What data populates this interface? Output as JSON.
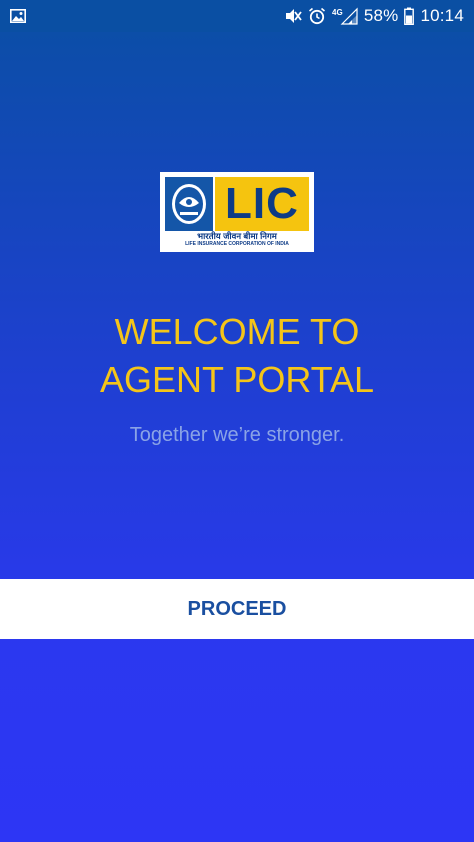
{
  "status_bar": {
    "battery": "58%",
    "time": "10:14",
    "network": "4G",
    "icons": [
      "image-icon",
      "mute-icon",
      "alarm-icon",
      "signal-icon",
      "battery-icon"
    ]
  },
  "logo": {
    "name": "LIC",
    "hindi": "भारतीय जीवन बीमा निगम",
    "subtitle": "LIFE INSURANCE CORPORATION OF INDIA"
  },
  "welcome": {
    "line1": "WELCOME TO",
    "line2": "AGENT PORTAL",
    "tagline": "Together we’re stronger."
  },
  "actions": {
    "proceed_label": "PROCEED"
  },
  "colors": {
    "status_bar": "#0a4fa3",
    "heading": "#f5c518",
    "tagline": "#8aa3e6",
    "button_text": "#1a4fa0"
  }
}
